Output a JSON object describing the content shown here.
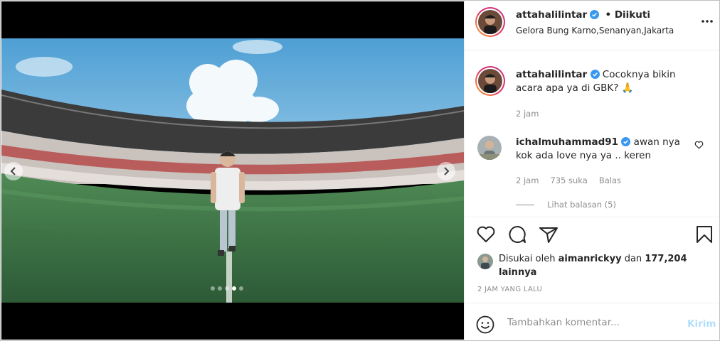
{
  "post": {
    "username": "attahalilintar",
    "follow_state": "• Diikuti",
    "location": "Gelora Bung Karno,Senanyan,Jakarta",
    "more_icon": "more-horizontal-icon",
    "carousel": {
      "total": 5,
      "active_index": 3
    }
  },
  "caption": {
    "username": "attahalilintar",
    "text": "Cocoknya bikin acara apa ya di GBK? 🙏",
    "time": "2 jam"
  },
  "comments": [
    {
      "username": "ichalmuhammad91",
      "text": "awan nya kok ada love nya ya .. keren",
      "time": "2 jam",
      "likes": "735 suka",
      "reply_label": "Balas",
      "view_replies": "Lihat balasan (5)"
    }
  ],
  "likes": {
    "prefix": "Disukai oleh",
    "user": "aimanrickyy",
    "joiner": "dan",
    "others": "177,204 lainnya"
  },
  "timestamp": "2 JAM YANG LALU",
  "comment_box": {
    "placeholder": "Tambahkan komentar...",
    "post_label": "Kirim"
  },
  "colors": {
    "verified": "#3897f0",
    "post_button_disabled": "#b2dffc",
    "secondary_text": "#8e8e8e"
  }
}
